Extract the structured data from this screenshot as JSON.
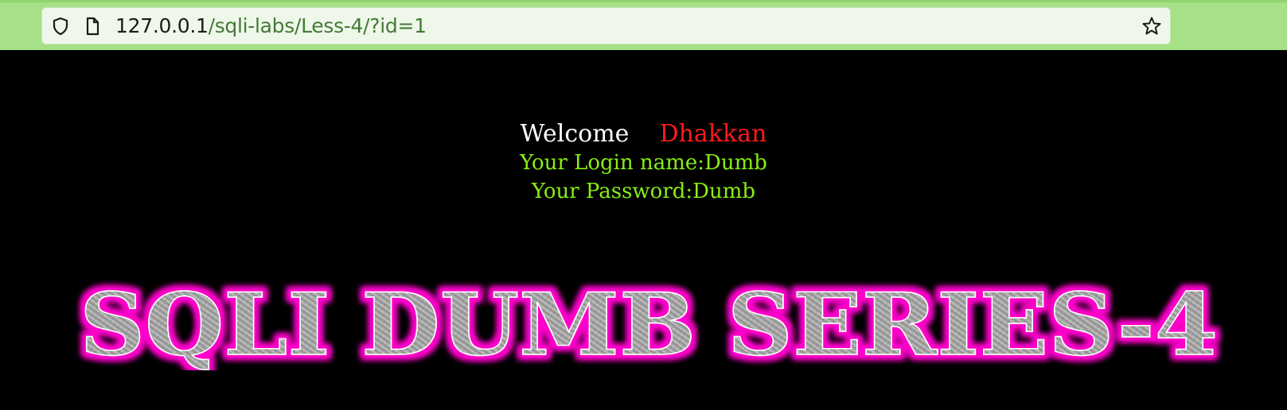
{
  "browser": {
    "url_host": "127.0.0.1",
    "url_path": "/sqli-labs/Less-4/?id=1",
    "icons": {
      "shield": "shield-icon",
      "page": "page-icon",
      "star": "bookmark-star-icon"
    }
  },
  "page": {
    "welcome_label": "Welcome",
    "welcome_name": "Dhakkan",
    "login_name_line": "Your Login name:Dumb",
    "password_line": "Your Password:Dumb",
    "banner_text": "SQLI DUMB SERIES-4"
  },
  "colors": {
    "background": "#000000",
    "toolbar": "#a6e187",
    "welcome": "#ffffff",
    "name": "#ff1a1a",
    "credentials": "#88ee11",
    "banner_glow": "#ff00cc",
    "banner_fill": "#9a9a9a"
  }
}
